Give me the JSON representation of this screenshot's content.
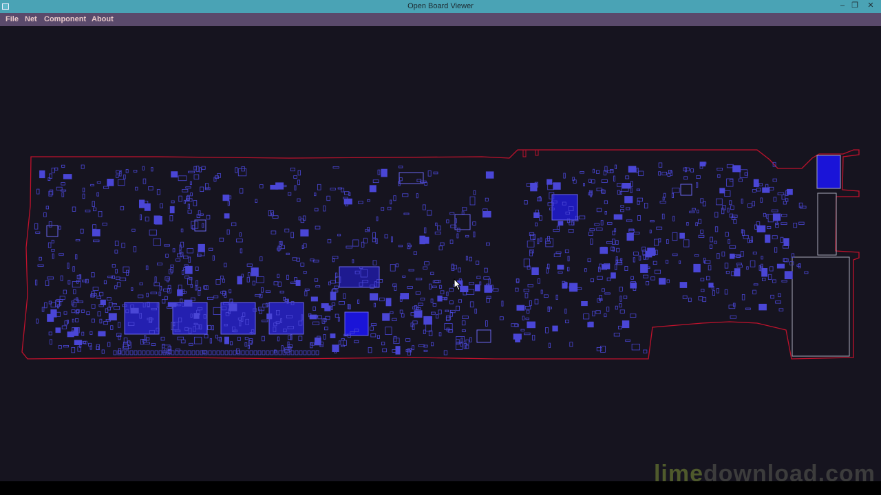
{
  "window": {
    "title": "Open Board Viewer",
    "minimize": "–",
    "maximize": "❐",
    "close": "✕"
  },
  "menu": {
    "file": "File",
    "net": "Net",
    "component": "Component",
    "about": "About"
  },
  "watermark": {
    "part1": "lime",
    "part2": "download.com"
  },
  "colors": {
    "board_outline": "#c0122c",
    "parts": "#4a46d6",
    "filled_parts": "#1a14d8",
    "background": "#16141f"
  }
}
